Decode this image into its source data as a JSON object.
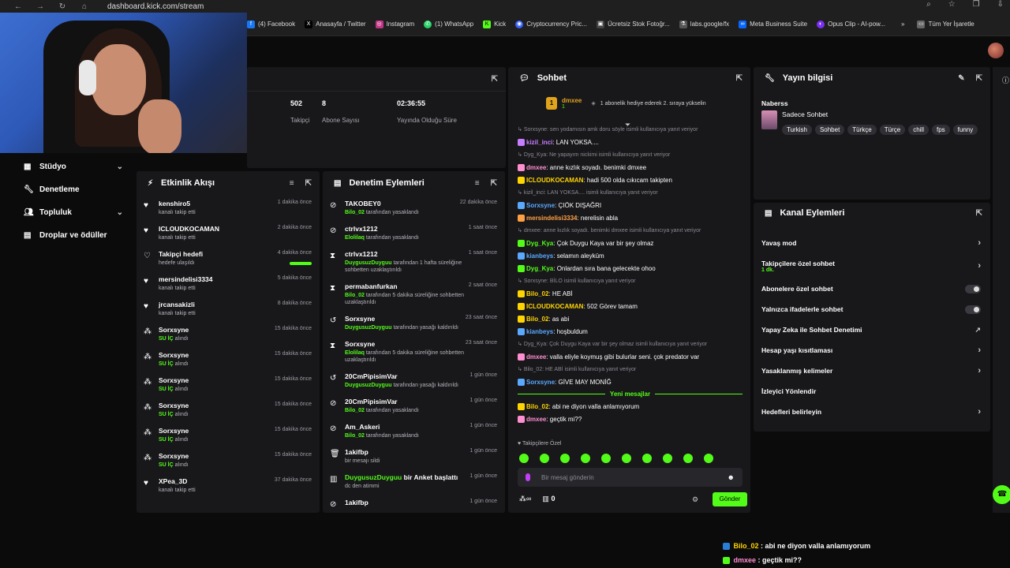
{
  "browser": {
    "url": "dashboard.kick.com/stream",
    "bookmarks": [
      "(4) Facebook",
      "Anasayfa / Twitter",
      "Instagram",
      "(1) WhatsApp",
      "Kick",
      "Cryptocurrency Pric...",
      "Ücretsiz Stok Fotoğr...",
      "labs.google/fx",
      "Meta Business Suite",
      "Opus Clip - AI-pow..."
    ],
    "all_bookmarks": "Tüm Yer İşaretle"
  },
  "sidebar": {
    "items": [
      {
        "label": "Stüdyo",
        "icon": "studio-icon",
        "expandable": true
      },
      {
        "label": "Denetleme",
        "icon": "wrench-icon",
        "expandable": false
      },
      {
        "label": "Topluluk",
        "icon": "community-icon",
        "expandable": true
      },
      {
        "label": "Droplar ve ödüller",
        "icon": "gift-icon",
        "expandable": false
      }
    ]
  },
  "stats": [
    {
      "value": "502",
      "label": "Takipçi"
    },
    {
      "value": "8",
      "label": "Abone Sayısı"
    },
    {
      "value": "02:36:55",
      "label": "Yayında Olduğu Süre"
    }
  ],
  "activity": {
    "title": "Etkinlik Akışı",
    "items": [
      {
        "icon": "heart-icon",
        "name": "kenshiro5",
        "sub": "kanalı takip etti",
        "time": "1 dakika önce"
      },
      {
        "icon": "heart-icon",
        "name": "ICLOUDKOCAMAN",
        "sub": "kanalı takip etti",
        "time": "2 dakika önce"
      },
      {
        "icon": "heart-outline-icon",
        "name": "Takipçi hedefi",
        "sub": "hedefe ulaşıldı",
        "time": "4 dakika önce"
      },
      {
        "icon": "heart-icon",
        "name": "mersindelisi3334",
        "sub": "kanalı takip etti",
        "time": "5 dakika önce"
      },
      {
        "icon": "heart-icon",
        "name": "jrcansakizli",
        "sub": "kanalı takip etti",
        "time": "8 dakika önce"
      },
      {
        "icon": "sub-icon",
        "name": "Sorxsyne",
        "sub_green": "SU İÇ",
        "sub": " alındı",
        "time": "15 dakika önce"
      },
      {
        "icon": "sub-icon",
        "name": "Sorxsyne",
        "sub_green": "SU İÇ",
        "sub": " alındı",
        "time": "15 dakika önce"
      },
      {
        "icon": "sub-icon",
        "name": "Sorxsyne",
        "sub_green": "SU İÇ",
        "sub": " alındı",
        "time": "15 dakika önce"
      },
      {
        "icon": "sub-icon",
        "name": "Sorxsyne",
        "sub_green": "SU İÇ",
        "sub": " alındı",
        "time": "15 dakika önce"
      },
      {
        "icon": "sub-icon",
        "name": "Sorxsyne",
        "sub_green": "SU İÇ",
        "sub": " alındı",
        "time": "15 dakika önce"
      },
      {
        "icon": "sub-icon",
        "name": "Sorxsyne",
        "sub_green": "SU İÇ",
        "sub": " alındı",
        "time": "15 dakika önce"
      },
      {
        "icon": "heart-icon",
        "name": "XPea_3D",
        "sub": "kanalı takip etti",
        "time": "37 dakika önce"
      }
    ]
  },
  "moderation": {
    "title": "Denetim Eylemleri",
    "items": [
      {
        "icon": "ban-icon",
        "name": "TAKOBEY0",
        "actor": "Bilo_02",
        "sub": " tarafından yasaklandı",
        "time": "22 dakika önce"
      },
      {
        "icon": "ban-icon",
        "name": "ctrlvx1212",
        "actor": "Elolilaq",
        "sub": " tarafından yasaklandı",
        "time": "1 saat önce"
      },
      {
        "icon": "timeout-icon",
        "name": "ctrlvx1212",
        "actor": "DuygusuzDuyguu",
        "sub": " tarafından 1 hafta süreliğine sohbetten uzaklaştırıldı",
        "time": "1 saat önce"
      },
      {
        "icon": "timeout-icon",
        "name": "permabanfurkan",
        "actor": "Bilo_02",
        "sub": " tarafından 5 dakika süreliğine sohbetten uzaklaştırıldı",
        "time": "2 saat önce"
      },
      {
        "icon": "undo-icon",
        "name": "Sorxsyne",
        "actor": "DuygusuzDuyguu",
        "sub": " tarafından yasağı kaldırıldı",
        "time": "23 saat önce"
      },
      {
        "icon": "timeout-icon",
        "name": "Sorxsyne",
        "actor": "Elolilaq",
        "sub": " tarafından 5 dakika süreliğine sohbetten uzaklaştırıldı",
        "time": "23 saat önce"
      },
      {
        "icon": "undo-icon",
        "name": "20CmPipisimVar",
        "actor": "DuygusuzDuyguu",
        "sub": " tarafından yasağı kaldırıldı",
        "time": "1 gün önce"
      },
      {
        "icon": "ban-icon",
        "name": "20CmPipisimVar",
        "actor": "Bilo_02",
        "sub": " tarafından yasaklandı",
        "time": "1 gün önce"
      },
      {
        "icon": "ban-icon",
        "name": "Am_Askeri",
        "actor": "Bilo_02",
        "sub": " tarafından yasaklandı",
        "time": "1 gün önce"
      },
      {
        "icon": "trash-icon",
        "name": "1akifbp",
        "actor": "",
        "sub": "bir mesajı sildi",
        "time": "1 gün önce"
      },
      {
        "icon": "poll-icon",
        "name_green": "DuygusuzDuyguu",
        "name": " bir Anket başlattı",
        "actor": "",
        "sub": "dc den atimmi",
        "time": "1 gün önce"
      },
      {
        "icon": "ban-icon",
        "name": "1akifbp",
        "actor": "",
        "sub": "",
        "time": "1 gün önce"
      }
    ]
  },
  "chat": {
    "title": "Sohbet",
    "pinned_user": "dmxee",
    "pinned_count": "1",
    "pinned_text": "1 abonelik hediye ederek 2. sıraya yükselin",
    "messages": [
      {
        "type": "sys",
        "text": "Sorxsyne: sen yodamısın amk doru söyle isimli kullanıcıya yanıt veriyor"
      },
      {
        "type": "msg",
        "user": "kizil_inci",
        "color": "#c77dff",
        "text": ": LAN YOKSA...."
      },
      {
        "type": "sys",
        "text": "Dyg_Kya: Ne yapayım nickimi isimli kullanıcıya yanıt veriyor"
      },
      {
        "type": "msg",
        "user": "dmxee",
        "color": "#ff8fd0",
        "text": ": anne kızlık soyadı. benimki dmxee"
      },
      {
        "type": "msg",
        "user": "ICLOUDKOCAMAN",
        "color": "#ffd400",
        "text": ": hadi 500 olda cıkıcam takipten"
      },
      {
        "type": "sys",
        "text": "kizil_inci: LAN YOKSA.... isimli kullanıcıya yanıt veriyor"
      },
      {
        "type": "msg",
        "user": "Sorxsyne",
        "color": "#5aa9ff",
        "text": ": ÇIÖK DIŞAĞRI"
      },
      {
        "type": "msg",
        "user": "mersindelisi3334",
        "color": "#ff9f43",
        "text": ": nerelisin abla"
      },
      {
        "type": "sys",
        "text": "dmxee: anne kızlık soyadı. benimki dmxee isimli kullanıcıya yanıt veriyor"
      },
      {
        "type": "msg",
        "user": "Dyg_Kya",
        "color": "#53fc18",
        "text": ": Çok Duygu Kaya var bir şey olmaz"
      },
      {
        "type": "msg",
        "user": "kianbeys",
        "color": "#5aa9ff",
        "text": ": selamın aleyküm"
      },
      {
        "type": "msg",
        "user": "Dyg_Kya",
        "color": "#53fc18",
        "text": ": Onlardan sıra bana gelecekte ohoo"
      },
      {
        "type": "sys",
        "text": "Sorxsyne: BİLO isimli kullanıcıya yanıt veriyor"
      },
      {
        "type": "msg",
        "user": "Bilo_02",
        "color": "#ffd400",
        "text": ": HE ABİ"
      },
      {
        "type": "msg",
        "user": "ICLOUDKOCAMAN",
        "color": "#ffd400",
        "text": ": 502 Görev tamam"
      },
      {
        "type": "msg",
        "user": "Bilo_02",
        "color": "#ffd400",
        "text": ": as abi"
      },
      {
        "type": "msg",
        "user": "kianbeys",
        "color": "#5aa9ff",
        "text": ": hoşbuldum"
      },
      {
        "type": "sys",
        "text": "Dyg_Kya: Çok Duygu Kaya var bir şey olmaz isimli kullanıcıya yanıt veriyor"
      },
      {
        "type": "msg",
        "user": "dmxee",
        "color": "#ff8fd0",
        "text": ": valla eliyle koymuş gibi bulurlar seni. çok predator var"
      },
      {
        "type": "sys",
        "text": "Bilo_02: HE ABİ isimli kullanıcıya yanıt veriyor"
      },
      {
        "type": "msg",
        "user": "Sorxsyne",
        "color": "#5aa9ff",
        "text": ": GİVE MAY MONİĞ"
      }
    ],
    "new_messages_label": "Yeni mesajlar",
    "new_messages": [
      {
        "type": "msg",
        "user": "Bilo_02",
        "color": "#ffd400",
        "text": ": abi ne diyon valla anlamıyorum"
      },
      {
        "type": "msg",
        "user": "dmxee",
        "color": "#ff8fd0",
        "text": ": geçtik mi??"
      }
    ],
    "emote_label": "Takipçilere Özel",
    "input_placeholder": "Bir mesaj gönderin",
    "points": "0",
    "send_label": "Gönder"
  },
  "stream_info": {
    "title": "Yayın bilgisi",
    "channel": "Naberss",
    "stream_title": "Sadece Sohbet",
    "tags": [
      "Turkish",
      "Sohbet",
      "Türkçe",
      "Türçe",
      "chill",
      "fps",
      "funny"
    ]
  },
  "channel_actions": {
    "title": "Kanal Eylemleri",
    "items": [
      {
        "label": "Yavaş mod",
        "control": "chevron"
      },
      {
        "label": "Takipçilere özel sohbet",
        "sub": "1 dk.",
        "control": "chevron"
      },
      {
        "label": "Abonelere özel sohbet",
        "control": "toggle"
      },
      {
        "label": "Yalnızca ifadelerle sohbet",
        "control": "toggle"
      },
      {
        "label": "Yapay Zeka ile Sohbet Denetimi",
        "control": "external"
      },
      {
        "label": "Hesap yaşı kısıtlaması",
        "control": "chevron"
      },
      {
        "label": "Yasaklanmış kelimeler",
        "control": "chevron"
      },
      {
        "label": "İzleyici Yönlendir",
        "control": "none"
      },
      {
        "label": "Hedefleri belirleyin",
        "control": "chevron"
      }
    ]
  },
  "overlay": [
    {
      "user": "Bilo_02",
      "text": " : abi ne diyon valla anlamıyorum"
    },
    {
      "user": "dmxee",
      "text": " : geçtik mi??"
    }
  ],
  "colors": {
    "accent": "#53fc18",
    "panel": "#18181b",
    "background": "#0b0b0c"
  }
}
